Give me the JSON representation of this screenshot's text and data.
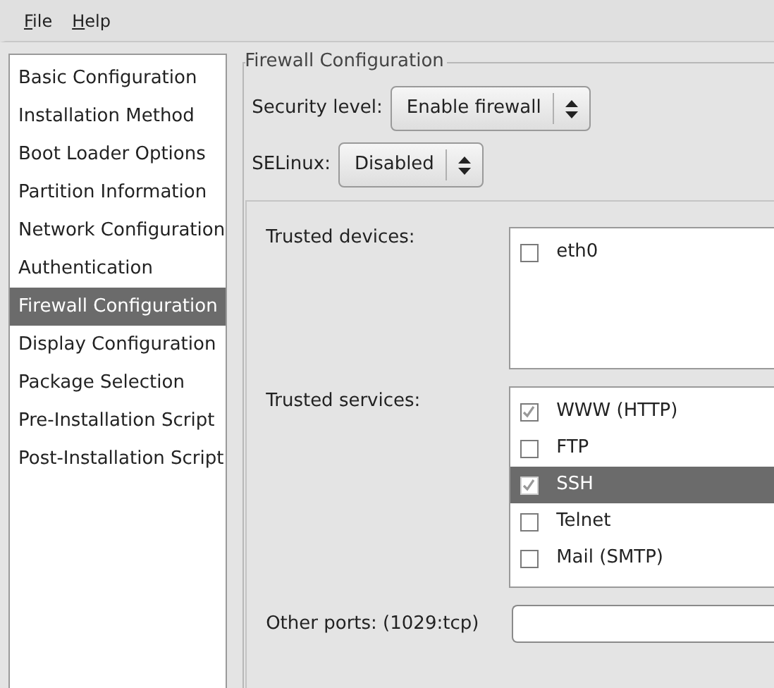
{
  "menu": [
    {
      "label": "File"
    },
    {
      "label": "Help"
    }
  ],
  "sidebar": {
    "items": [
      {
        "label": "Basic Configuration",
        "selected": false
      },
      {
        "label": "Installation Method",
        "selected": false
      },
      {
        "label": "Boot Loader Options",
        "selected": false
      },
      {
        "label": "Partition Information",
        "selected": false
      },
      {
        "label": "Network Configuration",
        "selected": false
      },
      {
        "label": "Authentication",
        "selected": false
      },
      {
        "label": "Firewall Configuration",
        "selected": true
      },
      {
        "label": "Display Configuration",
        "selected": false
      },
      {
        "label": "Package Selection",
        "selected": false
      },
      {
        "label": "Pre-Installation Script",
        "selected": false
      },
      {
        "label": "Post-Installation Script",
        "selected": false
      }
    ]
  },
  "firewall": {
    "legend": "Firewall Configuration",
    "security_level": {
      "label": "Security level:",
      "value": "Enable firewall"
    },
    "selinux": {
      "label": "SELinux:",
      "value": "Disabled"
    },
    "trusted_devices": {
      "label": "Trusted devices:",
      "items": [
        {
          "label": "eth0",
          "checked": false,
          "selected": false
        }
      ]
    },
    "trusted_services": {
      "label": "Trusted services:",
      "items": [
        {
          "label": "WWW (HTTP)",
          "checked": true,
          "selected": false
        },
        {
          "label": "FTP",
          "checked": false,
          "selected": false
        },
        {
          "label": "SSH",
          "checked": true,
          "selected": true
        },
        {
          "label": "Telnet",
          "checked": false,
          "selected": false
        },
        {
          "label": "Mail (SMTP)",
          "checked": false,
          "selected": false
        }
      ]
    },
    "other_ports": {
      "label": "Other ports: (1029:tcp)"
    }
  }
}
